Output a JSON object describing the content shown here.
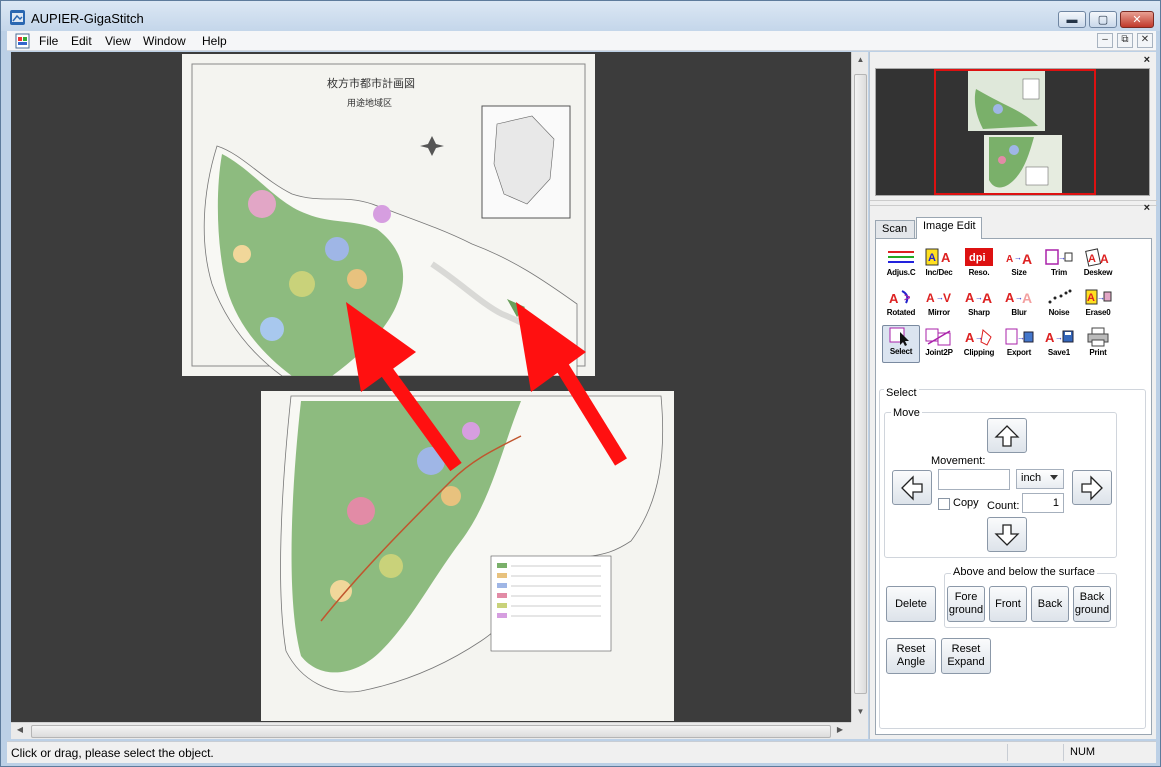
{
  "window": {
    "title": "AUPIER-GigaStitch",
    "caption_buttons": {
      "minimize": "▬",
      "maximize": "▢",
      "close": "✕"
    }
  },
  "menu": {
    "items": [
      "File",
      "Edit",
      "View",
      "Window",
      "Help"
    ],
    "mdi_buttons": [
      "–",
      "⧉",
      "✕"
    ]
  },
  "panel": {
    "close_glyph": "×",
    "tabs": [
      "Scan",
      "Image Edit"
    ],
    "active_tab": "Image Edit",
    "tools_row1": [
      "Adjus.C",
      "Inc/Dec",
      "Reso.",
      "Size",
      "Trim",
      "Deskew"
    ],
    "tools_row2": [
      "Rotated",
      "Mirror",
      "Sharp",
      "Blur",
      "Noise",
      "Erase0"
    ],
    "tools_row3": [
      "Select",
      "Joint2P",
      "Clipping",
      "Export",
      "Save1",
      "Print"
    ],
    "tool_icon_text": {
      "reso": "dpi"
    },
    "selected_tool": "Select",
    "select_group": {
      "title": "Select",
      "move_title": "Move",
      "movement_label": "Movement:",
      "movement_value": "",
      "unit": "inch",
      "copy_label": "Copy",
      "count_label": "Count:",
      "count_value": "1"
    },
    "surface_group": {
      "title": "Above and below the surface",
      "buttons": [
        "Fore ground",
        "Front",
        "Back",
        "Back ground"
      ]
    },
    "delete_label": "Delete",
    "reset_angle_label": "Reset Angle",
    "reset_expand_label": "Reset Expand"
  },
  "status": {
    "message": "Click or drag, please select the object.",
    "num": "NUM"
  },
  "map": {
    "title_text": "枚方市都市計画図",
    "subtitle_text": "用途地域区"
  },
  "colors": {
    "canvas_bg": "#3c3c3c",
    "arrow": "#ff1010",
    "overview_frame": "#dd1111"
  }
}
